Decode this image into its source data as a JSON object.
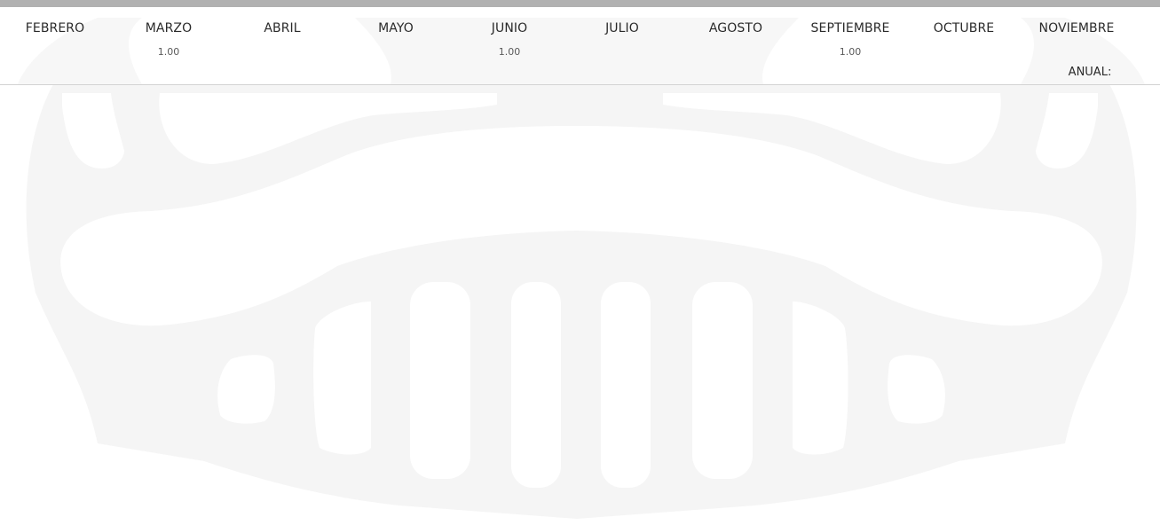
{
  "months": [
    {
      "label": "FEBRERO",
      "value": ""
    },
    {
      "label": "MARZO",
      "value": "1.00"
    },
    {
      "label": "ABRIL",
      "value": ""
    },
    {
      "label": "MAYO",
      "value": ""
    },
    {
      "label": "JUNIO",
      "value": "1.00"
    },
    {
      "label": "JULIO",
      "value": ""
    },
    {
      "label": "AGOSTO",
      "value": ""
    },
    {
      "label": "SEPTIEMBRE",
      "value": "1.00"
    },
    {
      "label": "OCTUBRE",
      "value": ""
    },
    {
      "label": "NOVIEMBRE",
      "value": ""
    }
  ],
  "annual": {
    "label": "ANUAL:"
  },
  "colors": {
    "top_bar": "#b1b1b1",
    "watermark": "#f5f5f5",
    "divider": "#d3d3d3"
  },
  "watermark_icon": "jeep-grille-icon"
}
